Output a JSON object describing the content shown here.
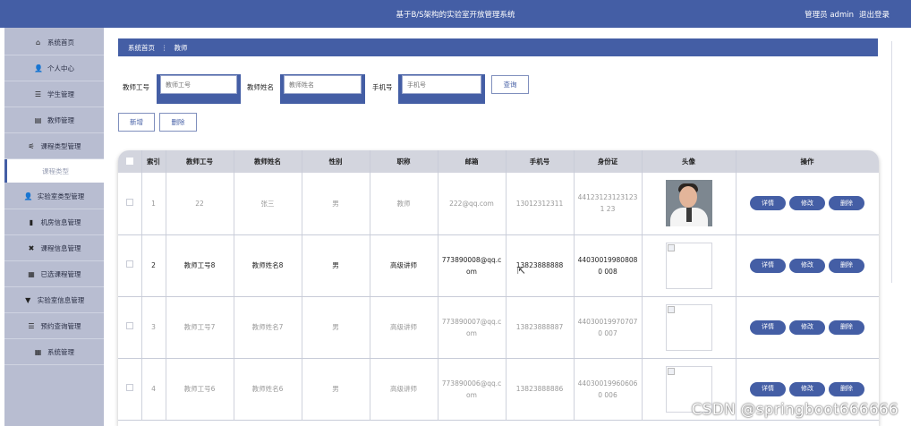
{
  "header": {
    "title": "基于B/S架构的实验室开放管理系统",
    "user": "管理员 admin",
    "logout": "退出登录"
  },
  "sidebar": {
    "items": [
      {
        "label": "系统首页",
        "icon": "home-icon",
        "glyph": "⌂"
      },
      {
        "label": "个人中心",
        "icon": "user-icon",
        "glyph": "👤"
      },
      {
        "label": "学生管理",
        "icon": "list-icon",
        "glyph": "☰"
      },
      {
        "label": "教师管理",
        "icon": "chart-icon",
        "glyph": "▤"
      },
      {
        "label": "课程类型管理",
        "icon": "sliders-icon",
        "glyph": "⚟"
      },
      {
        "label": "实验室类型管理",
        "icon": "user-icon",
        "glyph": "👤"
      },
      {
        "label": "机房信息管理",
        "icon": "bar-chart-icon",
        "glyph": "▮"
      },
      {
        "label": "课程信息管理",
        "icon": "crossed-icon",
        "glyph": "✖"
      },
      {
        "label": "已选课程管理",
        "icon": "grid-icon",
        "glyph": "▦"
      },
      {
        "label": "实验室信息管理",
        "icon": "filter-icon",
        "glyph": "▼"
      },
      {
        "label": "预约查询管理",
        "icon": "list-icon",
        "glyph": "☰"
      },
      {
        "label": "系统管理",
        "icon": "grid-icon",
        "glyph": "▦"
      }
    ],
    "sub_item": "课程类型"
  },
  "breadcrumb": {
    "home": "系统首页",
    "separator": "⋮",
    "current": "教师"
  },
  "search": {
    "teacher_no_label": "教师工号",
    "teacher_no_placeholder": "教师工号",
    "teacher_name_label": "教师姓名",
    "teacher_name_placeholder": "教师姓名",
    "phone_label": "手机号",
    "phone_placeholder": "手机号",
    "query_button": "查询"
  },
  "actions": {
    "add": "新增",
    "delete": "删除"
  },
  "table": {
    "headers": [
      "",
      "索引",
      "教师工号",
      "教师姓名",
      "性别",
      "职称",
      "邮箱",
      "手机号",
      "身份证",
      "头像",
      "操作"
    ],
    "row_buttons": {
      "detail": "详情",
      "edit": "修改",
      "delete": "删除"
    },
    "rows": [
      {
        "index": "1",
        "no": "22",
        "name": "张三",
        "gender": "男",
        "title": "教师",
        "email": "222@qq.com",
        "phone": "13012312311",
        "id_card": "441231231231231 23",
        "avatar": "photo"
      },
      {
        "index": "2",
        "no": "教师工号8",
        "name": "教师姓名8",
        "gender": "男",
        "title": "高级讲师",
        "email": "773890008@qq.c om",
        "phone": "13823888888",
        "id_card": "440300199808080 008",
        "avatar": "broken"
      },
      {
        "index": "3",
        "no": "教师工号7",
        "name": "教师姓名7",
        "gender": "男",
        "title": "高级讲师",
        "email": "773890007@qq.c om",
        "phone": "13823888887",
        "id_card": "440300199707070 007",
        "avatar": "broken"
      },
      {
        "index": "4",
        "no": "教师工号6",
        "name": "教师姓名6",
        "gender": "男",
        "title": "高级讲师",
        "email": "773890006@qq.c om",
        "phone": "13823888886",
        "id_card": "440300199606060 006",
        "avatar": "broken"
      }
    ]
  },
  "watermark": "CSDN @springboot666666",
  "colors": {
    "primary": "#445ea5",
    "sidebar": "#b8bdd1",
    "header_row": "#d3d5de"
  }
}
